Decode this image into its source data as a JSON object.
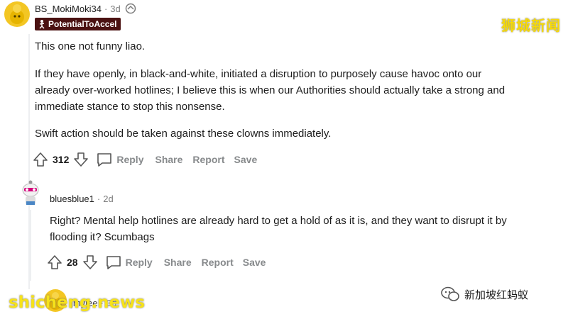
{
  "watermarks": {
    "top_right": "狮城新闻",
    "site": "shicheng.news",
    "wechat": "新加坡红蚂蚁"
  },
  "comment1": {
    "username": "BS_MokiMoki34",
    "time": "3d",
    "flair": "PotentialToAccel",
    "paragraphs": [
      "This one not funny liao.",
      "If they have openly, in black-and-white, initiated a disruption to purposely cause havoc onto our",
      "already over-worked hotlines; I believe this is when our Authorities should actually take a strong and",
      "immediate stance to stop this nonsense.",
      "Swift action should be taken against these clowns immediately."
    ],
    "votes": "312"
  },
  "comment2": {
    "username": "bluesblue1",
    "time": "2d",
    "lines": [
      "Right? Mental help hotlines are already hard to get a hold of as it is, and they want to disrupt it by",
      "flooding it? Scumbags"
    ],
    "votes": "28"
  },
  "comment3": {
    "username_partial": "jmylee",
    "time_partial": "3d"
  },
  "actions": {
    "reply": "Reply",
    "share": "Share",
    "report": "Report",
    "save": "Save"
  },
  "separator": "·"
}
